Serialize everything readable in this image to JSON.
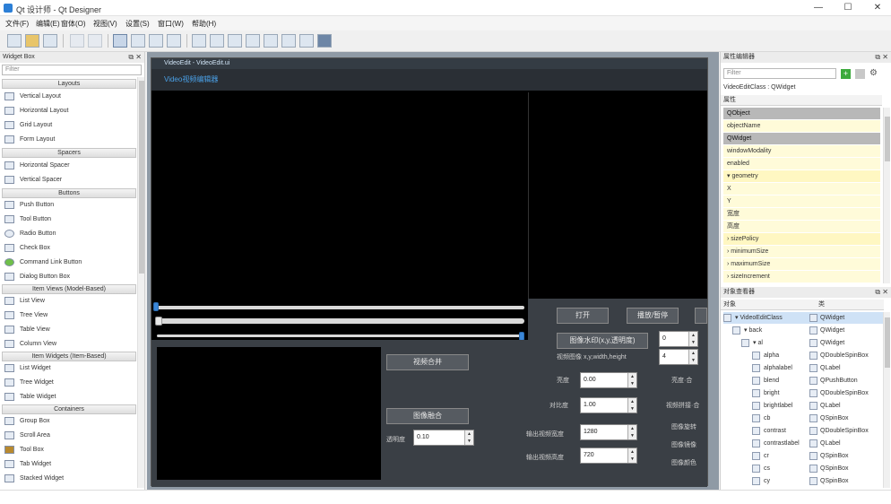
{
  "window": {
    "title": "Qt 设计师 - Qt Designer"
  },
  "menu": [
    "文件(F)",
    "编辑(E)",
    "窗体(O)",
    "视图(V)",
    "设置(S)",
    "窗口(W)",
    "帮助(H)"
  ],
  "widget_box": {
    "title": "Widget Box",
    "filter_placeholder": "Filter",
    "categories": [
      {
        "name": "Layouts",
        "items": [
          "Vertical Layout",
          "Horizontal Layout",
          "Grid Layout",
          "Form Layout"
        ]
      },
      {
        "name": "Spacers",
        "items": [
          "Horizontal Spacer",
          "Vertical Spacer"
        ]
      },
      {
        "name": "Buttons",
        "items": [
          "Push Button",
          "Tool Button",
          "Radio Button",
          "Check Box",
          "Command Link Button",
          "Dialog Button Box"
        ]
      },
      {
        "name": "Item Views (Model-Based)",
        "items": [
          "List View",
          "Tree View",
          "Table View",
          "Column View"
        ]
      },
      {
        "name": "Item Widgets (Item-Based)",
        "items": [
          "List Widget",
          "Tree Widget",
          "Table Widget"
        ]
      },
      {
        "name": "Containers",
        "items": [
          "Group Box",
          "Scroll Area",
          "Tool Box",
          "Tab Widget",
          "Stacked Widget"
        ]
      }
    ]
  },
  "form": {
    "window_title": "VideoEdit - VideoEdit.ui",
    "header": "Video视频编辑器",
    "buttons": {
      "open": "打开",
      "play_pause": "播放/暂停",
      "watermark": "图像水印(x,y,透明度)",
      "merge": "视频合并",
      "blend": "图像融合"
    },
    "labels": {
      "image_pos": "视频图像 x,y,width,height",
      "brightness": "亮度",
      "contrast": "对比度",
      "out_width": "输出视频宽度",
      "out_height": "输出视频高度",
      "opacity": "透明度",
      "right_1": "亮度·合",
      "right_2": "视频拼接·合",
      "right_3": "图像旋转",
      "right_4": "图像镜像",
      "right_5": "图像颜色"
    },
    "values": {
      "brightness": "0.00",
      "contrast": "1.00",
      "out_width": "1280",
      "out_height": "720",
      "opacity": "0.10",
      "pos_x": "0",
      "pos_y": "4"
    }
  },
  "property_editor": {
    "title": "属性编辑器",
    "filter_placeholder": "Filter",
    "object_label": "VideoEditClass : QWidget",
    "column": "属性",
    "rows": [
      {
        "kind": "sect",
        "text": "QObject"
      },
      {
        "kind": "val",
        "text": "objectName"
      },
      {
        "kind": "sect",
        "text": "QWidget"
      },
      {
        "kind": "val",
        "text": "windowModality"
      },
      {
        "kind": "val",
        "text": "enabled"
      },
      {
        "kind": "sub",
        "text": "▾ geometry"
      },
      {
        "kind": "val",
        "text": "X"
      },
      {
        "kind": "val",
        "text": "Y"
      },
      {
        "kind": "val",
        "text": "宽度"
      },
      {
        "kind": "val",
        "text": "高度"
      },
      {
        "kind": "sub",
        "text": "› sizePolicy"
      },
      {
        "kind": "val",
        "text": "› minimumSize"
      },
      {
        "kind": "val",
        "text": "› maximumSize"
      },
      {
        "kind": "val",
        "text": "› sizeIncrement"
      }
    ]
  },
  "object_inspector": {
    "title": "对象查看器",
    "col_object": "对象",
    "col_class": "类",
    "rows": [
      {
        "obj": "▾ VideoEditClass",
        "cls": "QWidget",
        "indent": 0,
        "sel": true
      },
      {
        "obj": "▾ back",
        "cls": "QWidget",
        "indent": 10,
        "sel": false
      },
      {
        "obj": "▾ al",
        "cls": "QWidget",
        "indent": 20,
        "sel": false
      },
      {
        "obj": "alpha",
        "cls": "QDoubleSpinBox",
        "indent": 32,
        "sel": false
      },
      {
        "obj": "alphalabel",
        "cls": "QLabel",
        "indent": 32,
        "sel": false
      },
      {
        "obj": "blend",
        "cls": "QPushButton",
        "indent": 32,
        "sel": false
      },
      {
        "obj": "bright",
        "cls": "QDoubleSpinBox",
        "indent": 32,
        "sel": false
      },
      {
        "obj": "brightlabel",
        "cls": "QLabel",
        "indent": 32,
        "sel": false
      },
      {
        "obj": "cb",
        "cls": "QSpinBox",
        "indent": 32,
        "sel": false
      },
      {
        "obj": "contrast",
        "cls": "QDoubleSpinBox",
        "indent": 32,
        "sel": false
      },
      {
        "obj": "contrastlabel",
        "cls": "QLabel",
        "indent": 32,
        "sel": false
      },
      {
        "obj": "cr",
        "cls": "QSpinBox",
        "indent": 32,
        "sel": false
      },
      {
        "obj": "cs",
        "cls": "QSpinBox",
        "indent": 32,
        "sel": false
      },
      {
        "obj": "cy",
        "cls": "QSpinBox",
        "indent": 32,
        "sel": false
      }
    ]
  }
}
